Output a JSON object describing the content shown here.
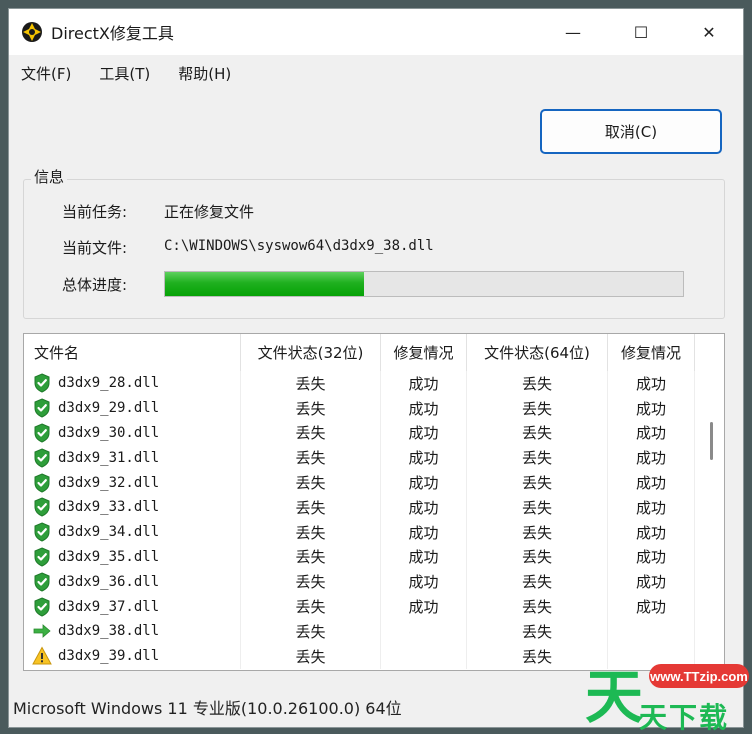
{
  "window": {
    "title": "DirectX修复工具",
    "controls": {
      "minimize": "—",
      "maximize": "☐",
      "close": "✕"
    }
  },
  "menu": [
    "文件(F)",
    "工具(T)",
    "帮助(H)"
  ],
  "cancel_label": "取消(C)",
  "info": {
    "group_title": "信息",
    "task_label": "当前任务:",
    "task_value": "正在修复文件",
    "file_label": "当前文件:",
    "file_value": "C:\\WINDOWS\\syswow64\\d3dx9_38.dll",
    "progress_label": "总体进度:",
    "progress_fraction": 0.385
  },
  "table": {
    "headers": [
      "文件名",
      "文件状态(32位)",
      "修复情况",
      "文件状态(64位)",
      "修复情况"
    ],
    "rows": [
      {
        "icon": "shield-check-icon",
        "name": "d3dx9_28.dll",
        "s32": "丢失",
        "r32": "成功",
        "s64": "丢失",
        "r64": "成功"
      },
      {
        "icon": "shield-check-icon",
        "name": "d3dx9_29.dll",
        "s32": "丢失",
        "r32": "成功",
        "s64": "丢失",
        "r64": "成功"
      },
      {
        "icon": "shield-check-icon",
        "name": "d3dx9_30.dll",
        "s32": "丢失",
        "r32": "成功",
        "s64": "丢失",
        "r64": "成功"
      },
      {
        "icon": "shield-check-icon",
        "name": "d3dx9_31.dll",
        "s32": "丢失",
        "r32": "成功",
        "s64": "丢失",
        "r64": "成功"
      },
      {
        "icon": "shield-check-icon",
        "name": "d3dx9_32.dll",
        "s32": "丢失",
        "r32": "成功",
        "s64": "丢失",
        "r64": "成功"
      },
      {
        "icon": "shield-check-icon",
        "name": "d3dx9_33.dll",
        "s32": "丢失",
        "r32": "成功",
        "s64": "丢失",
        "r64": "成功"
      },
      {
        "icon": "shield-check-icon",
        "name": "d3dx9_34.dll",
        "s32": "丢失",
        "r32": "成功",
        "s64": "丢失",
        "r64": "成功"
      },
      {
        "icon": "shield-check-icon",
        "name": "d3dx9_35.dll",
        "s32": "丢失",
        "r32": "成功",
        "s64": "丢失",
        "r64": "成功"
      },
      {
        "icon": "shield-check-icon",
        "name": "d3dx9_36.dll",
        "s32": "丢失",
        "r32": "成功",
        "s64": "丢失",
        "r64": "成功"
      },
      {
        "icon": "shield-check-icon",
        "name": "d3dx9_37.dll",
        "s32": "丢失",
        "r32": "成功",
        "s64": "丢失",
        "r64": "成功"
      },
      {
        "icon": "arrow-right-icon",
        "name": "d3dx9_38.dll",
        "s32": "丢失",
        "r32": "",
        "s64": "丢失",
        "r64": ""
      },
      {
        "icon": "warning-icon",
        "name": "d3dx9_39.dll",
        "s32": "丢失",
        "r32": "",
        "s64": "丢失",
        "r64": ""
      }
    ]
  },
  "status_bar": "Microsoft Windows 11 专业版(10.0.26100.0) 64位",
  "watermark": {
    "url": "www.TTzip.com",
    "big": "天",
    "sub": "天下载"
  },
  "colors": {
    "progress": "#1fb01f",
    "accent": "#1565c0",
    "watermark": "#1db954"
  }
}
